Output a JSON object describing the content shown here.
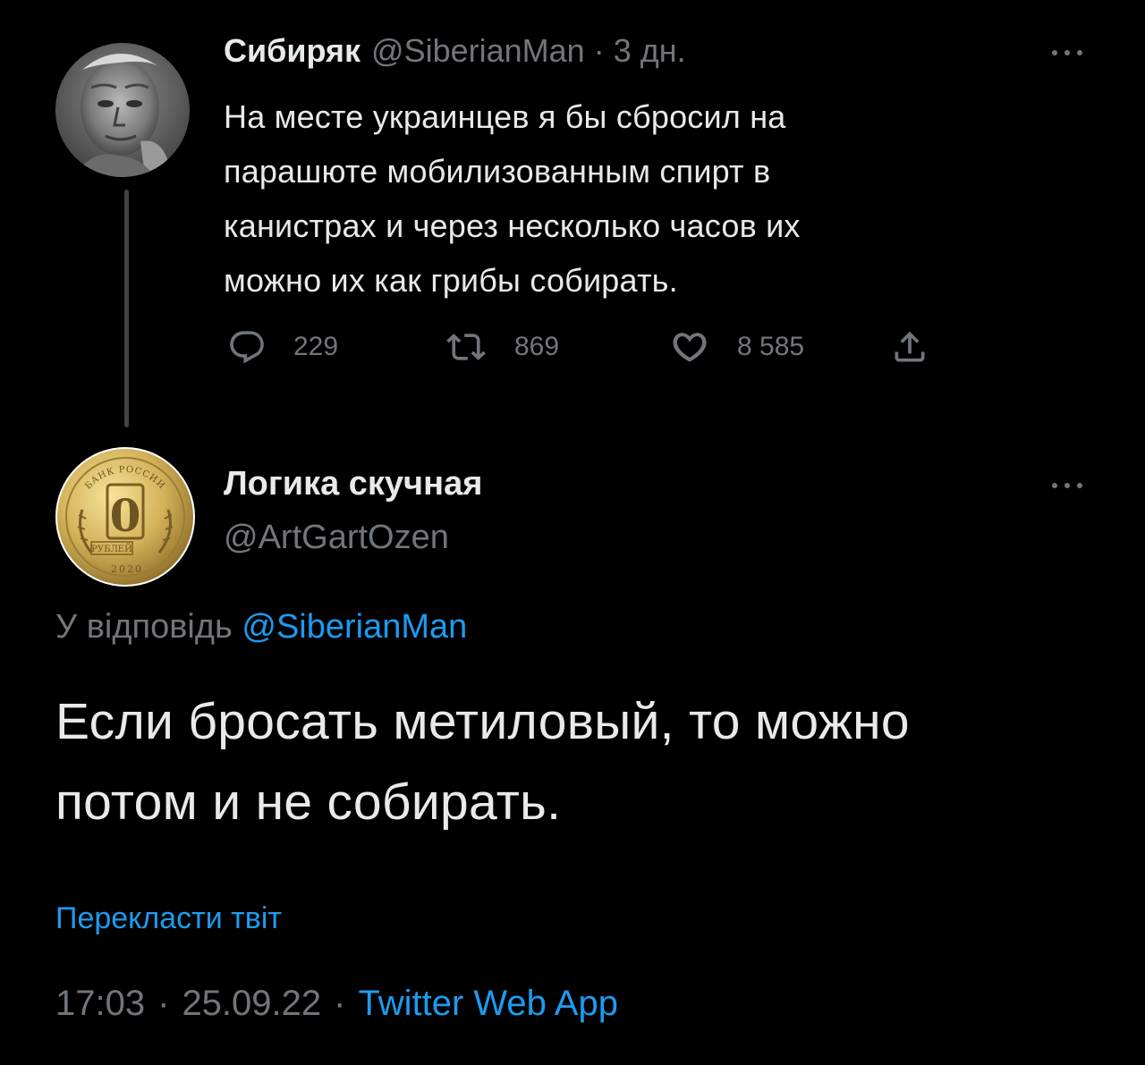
{
  "parent_tweet": {
    "author_name": "Сибиряк",
    "handle": "@SiberianMan",
    "separator": "·",
    "time_ago": "3 дн.",
    "text": "На месте украинцев я бы сбросил на\nпарашюте мобилизованным спирт в\nканистрах и через несколько часов их\nможно их как грибы собирать.",
    "replies_count": "229",
    "retweets_count": "869",
    "likes_count": "8 585"
  },
  "reply_tweet": {
    "author_name": "Логика скучная",
    "handle": "@ArtGartOzen",
    "replying_to_label": "У відповідь",
    "replying_to_handle": "@SiberianMan",
    "text": "Если бросать метиловый, то можно\nпотом и не собирать.",
    "translate_label": "Перекласти твіт",
    "time": "17:03",
    "separator": "·",
    "date": "25.09.22",
    "source_app": "Twitter Web App"
  },
  "coin_avatar": {
    "denomination": "0",
    "top_text": "БАНК РОССИИ",
    "bottom_text": "РУБЛЕЙ",
    "year": "2020"
  },
  "icons": {
    "more": "more-horizontal-icon",
    "reply": "reply-icon",
    "retweet": "retweet-icon",
    "like": "heart-icon",
    "share": "share-icon"
  },
  "colors": {
    "background": "#000000",
    "text_primary": "#e7e9ea",
    "text_secondary": "#71767b",
    "accent": "#1d9bf0",
    "thread_line": "#3f4448"
  }
}
